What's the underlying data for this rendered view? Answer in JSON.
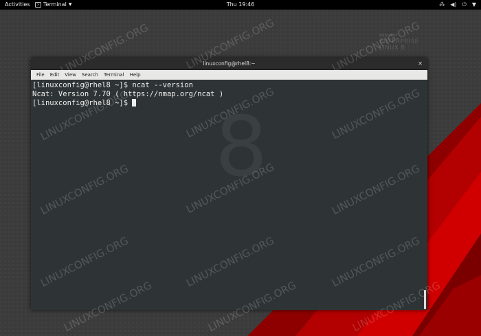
{
  "topbar": {
    "activities": "Activities",
    "app_name": "Terminal",
    "clock": "Thu 19:46"
  },
  "brand": {
    "line1": "RED HAT",
    "line2": "ENTERPRISE",
    "line3": "LINUX 8"
  },
  "window": {
    "title": "linuxconfig@rhel8:~",
    "menu": [
      "File",
      "Edit",
      "View",
      "Search",
      "Terminal",
      "Help"
    ]
  },
  "terminal": {
    "lines": [
      "[linuxconfig@rhel8 ~]$ ncat --version",
      "Ncat: Version 7.70 ( https://nmap.org/ncat )",
      "[linuxconfig@rhel8 ~]$ "
    ],
    "background_digit": "8"
  },
  "watermark": "LINUXCONFIG.ORG",
  "colors": {
    "desktop": "#3a3a3a",
    "accent_red": "#c00000",
    "terminal_bg": "#2e3436"
  }
}
